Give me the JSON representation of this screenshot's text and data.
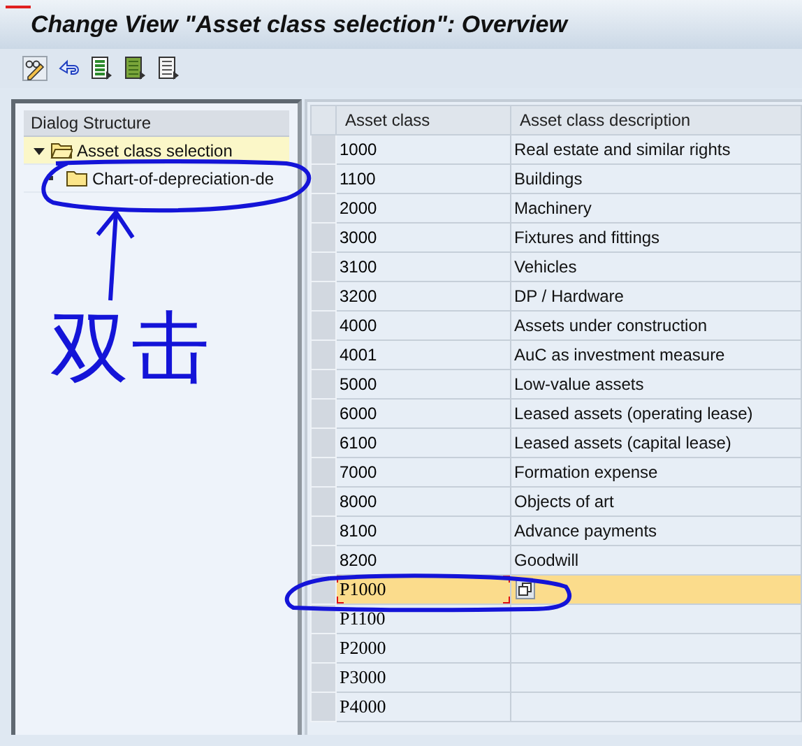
{
  "window": {
    "title": "Change View \"Asset class selection\": Overview"
  },
  "dialog_structure": {
    "title": "Dialog Structure",
    "nodes": [
      {
        "label": "Asset class selection",
        "selected": true,
        "expanded": true,
        "children": [
          {
            "label": "Chart-of-depreciation-de",
            "selected": false
          }
        ]
      }
    ]
  },
  "table": {
    "columns": [
      "Asset class",
      "Asset class description"
    ],
    "rows": [
      {
        "kind": "entry",
        "asset_class": "1000",
        "description": "Real estate and similar rights",
        "selected": false
      },
      {
        "kind": "entry",
        "asset_class": "1100",
        "description": "Buildings",
        "selected": false
      },
      {
        "kind": "entry",
        "asset_class": "2000",
        "description": "Machinery",
        "selected": false
      },
      {
        "kind": "entry",
        "asset_class": "3000",
        "description": "Fixtures and fittings",
        "selected": false
      },
      {
        "kind": "entry",
        "asset_class": "3100",
        "description": "Vehicles",
        "selected": false
      },
      {
        "kind": "entry",
        "asset_class": "3200",
        "description": "DP / Hardware",
        "selected": false
      },
      {
        "kind": "entry",
        "asset_class": "4000",
        "description": "Assets under construction",
        "selected": false
      },
      {
        "kind": "entry",
        "asset_class": "4001",
        "description": "AuC as investment measure",
        "selected": false
      },
      {
        "kind": "entry",
        "asset_class": "5000",
        "description": "Low-value assets",
        "selected": false
      },
      {
        "kind": "entry",
        "asset_class": "6000",
        "description": "Leased assets (operating lease)",
        "selected": false
      },
      {
        "kind": "entry",
        "asset_class": "6100",
        "description": "Leased assets (capital lease)",
        "selected": false
      },
      {
        "kind": "entry",
        "asset_class": "7000",
        "description": "Formation expense",
        "selected": false
      },
      {
        "kind": "entry",
        "asset_class": "8000",
        "description": "Objects of art",
        "selected": false
      },
      {
        "kind": "entry",
        "asset_class": "8100",
        "description": "Advance payments",
        "selected": false
      },
      {
        "kind": "entry",
        "asset_class": "8200",
        "description": "Goodwill",
        "selected": false
      },
      {
        "kind": "input",
        "asset_class": "P1000",
        "selected": true,
        "focused": true
      },
      {
        "kind": "input",
        "asset_class": "P1100",
        "selected": false,
        "focused": false
      },
      {
        "kind": "input",
        "asset_class": "P2000",
        "selected": false,
        "focused": false
      },
      {
        "kind": "input",
        "asset_class": "P3000",
        "selected": false,
        "focused": false
      },
      {
        "kind": "input",
        "asset_class": "P4000",
        "selected": false,
        "focused": false
      }
    ]
  },
  "annotations": {
    "handwriting": "双击"
  }
}
